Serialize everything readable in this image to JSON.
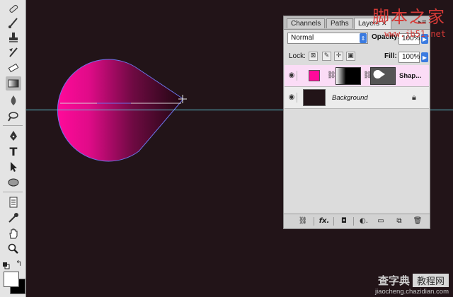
{
  "panel": {
    "tabs": [
      "Channels",
      "Paths",
      "Layers"
    ],
    "blend_mode": "Normal",
    "opacity_label": "Opacity:",
    "opacity_value": "100%",
    "lock_label": "Lock:",
    "fill_label": "Fill:",
    "fill_value": "100%",
    "layers": [
      {
        "name": "Shap...",
        "selected": true,
        "visible": true
      },
      {
        "name": "Background",
        "locked": true,
        "visible": true
      }
    ]
  },
  "colors": {
    "canvas": "#221418",
    "shape_light": "#ff0a9a",
    "shape_dark": "#1e0710",
    "guide": "#5cc6d6",
    "foreground": "#ffffff",
    "background": "#000000"
  },
  "toolbar": {
    "tools": [
      "healing-brush-icon",
      "brush-icon",
      "clone-stamp-icon",
      "history-brush-icon",
      "eraser-icon",
      "gradient-icon",
      "blur-icon",
      "dodge-icon",
      "pen-icon",
      "type-icon",
      "path-select-icon",
      "ellipse-icon",
      "notes-icon",
      "eyedropper-icon",
      "hand-icon",
      "zoom-icon"
    ],
    "active_tool": "gradient-icon"
  },
  "watermark": {
    "top_main": "脚本之家",
    "top_url": "www.jb51.net",
    "bottom_main": "查字典",
    "bottom_box": "教程网",
    "bottom_url": "jiaocheng.chazidian.com"
  }
}
